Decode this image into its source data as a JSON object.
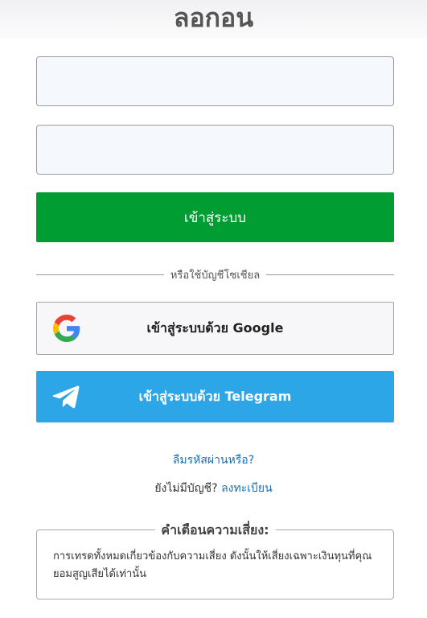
{
  "page": {
    "title": "ลอกอน"
  },
  "form": {
    "email_placeholder": "",
    "password_placeholder": "",
    "login_button": "เข้าสู่ระบบ",
    "divider_text": "หรือใช้บัญชีโซเชียล",
    "google_button": "เข้าสู่ระบบด้วย Google",
    "telegram_button": "เข้าสู่ระบบด้วย Telegram"
  },
  "links": {
    "forgot_password": "ลืมรหัสผ่านหรือ?",
    "no_account": "ยังไม่มีบัญชี?",
    "register": "ลงทะเบียน"
  },
  "risk_warning": {
    "title": "คำเตือนความเสี่ยง:",
    "text": "การเทรดทั้งหมดเกี่ยวข้องกับความเสี่ยง ดังนั้นให้เสี่ยงเฉพาะเงินทุนที่คุณยอมสูญเสียได้เท่านั้น"
  },
  "colors": {
    "login_button": "#009d32",
    "telegram_button": "#2ca6e6",
    "link": "#1a6fb5"
  },
  "icons": {
    "google": "google-g-icon",
    "telegram": "telegram-plane-icon"
  }
}
